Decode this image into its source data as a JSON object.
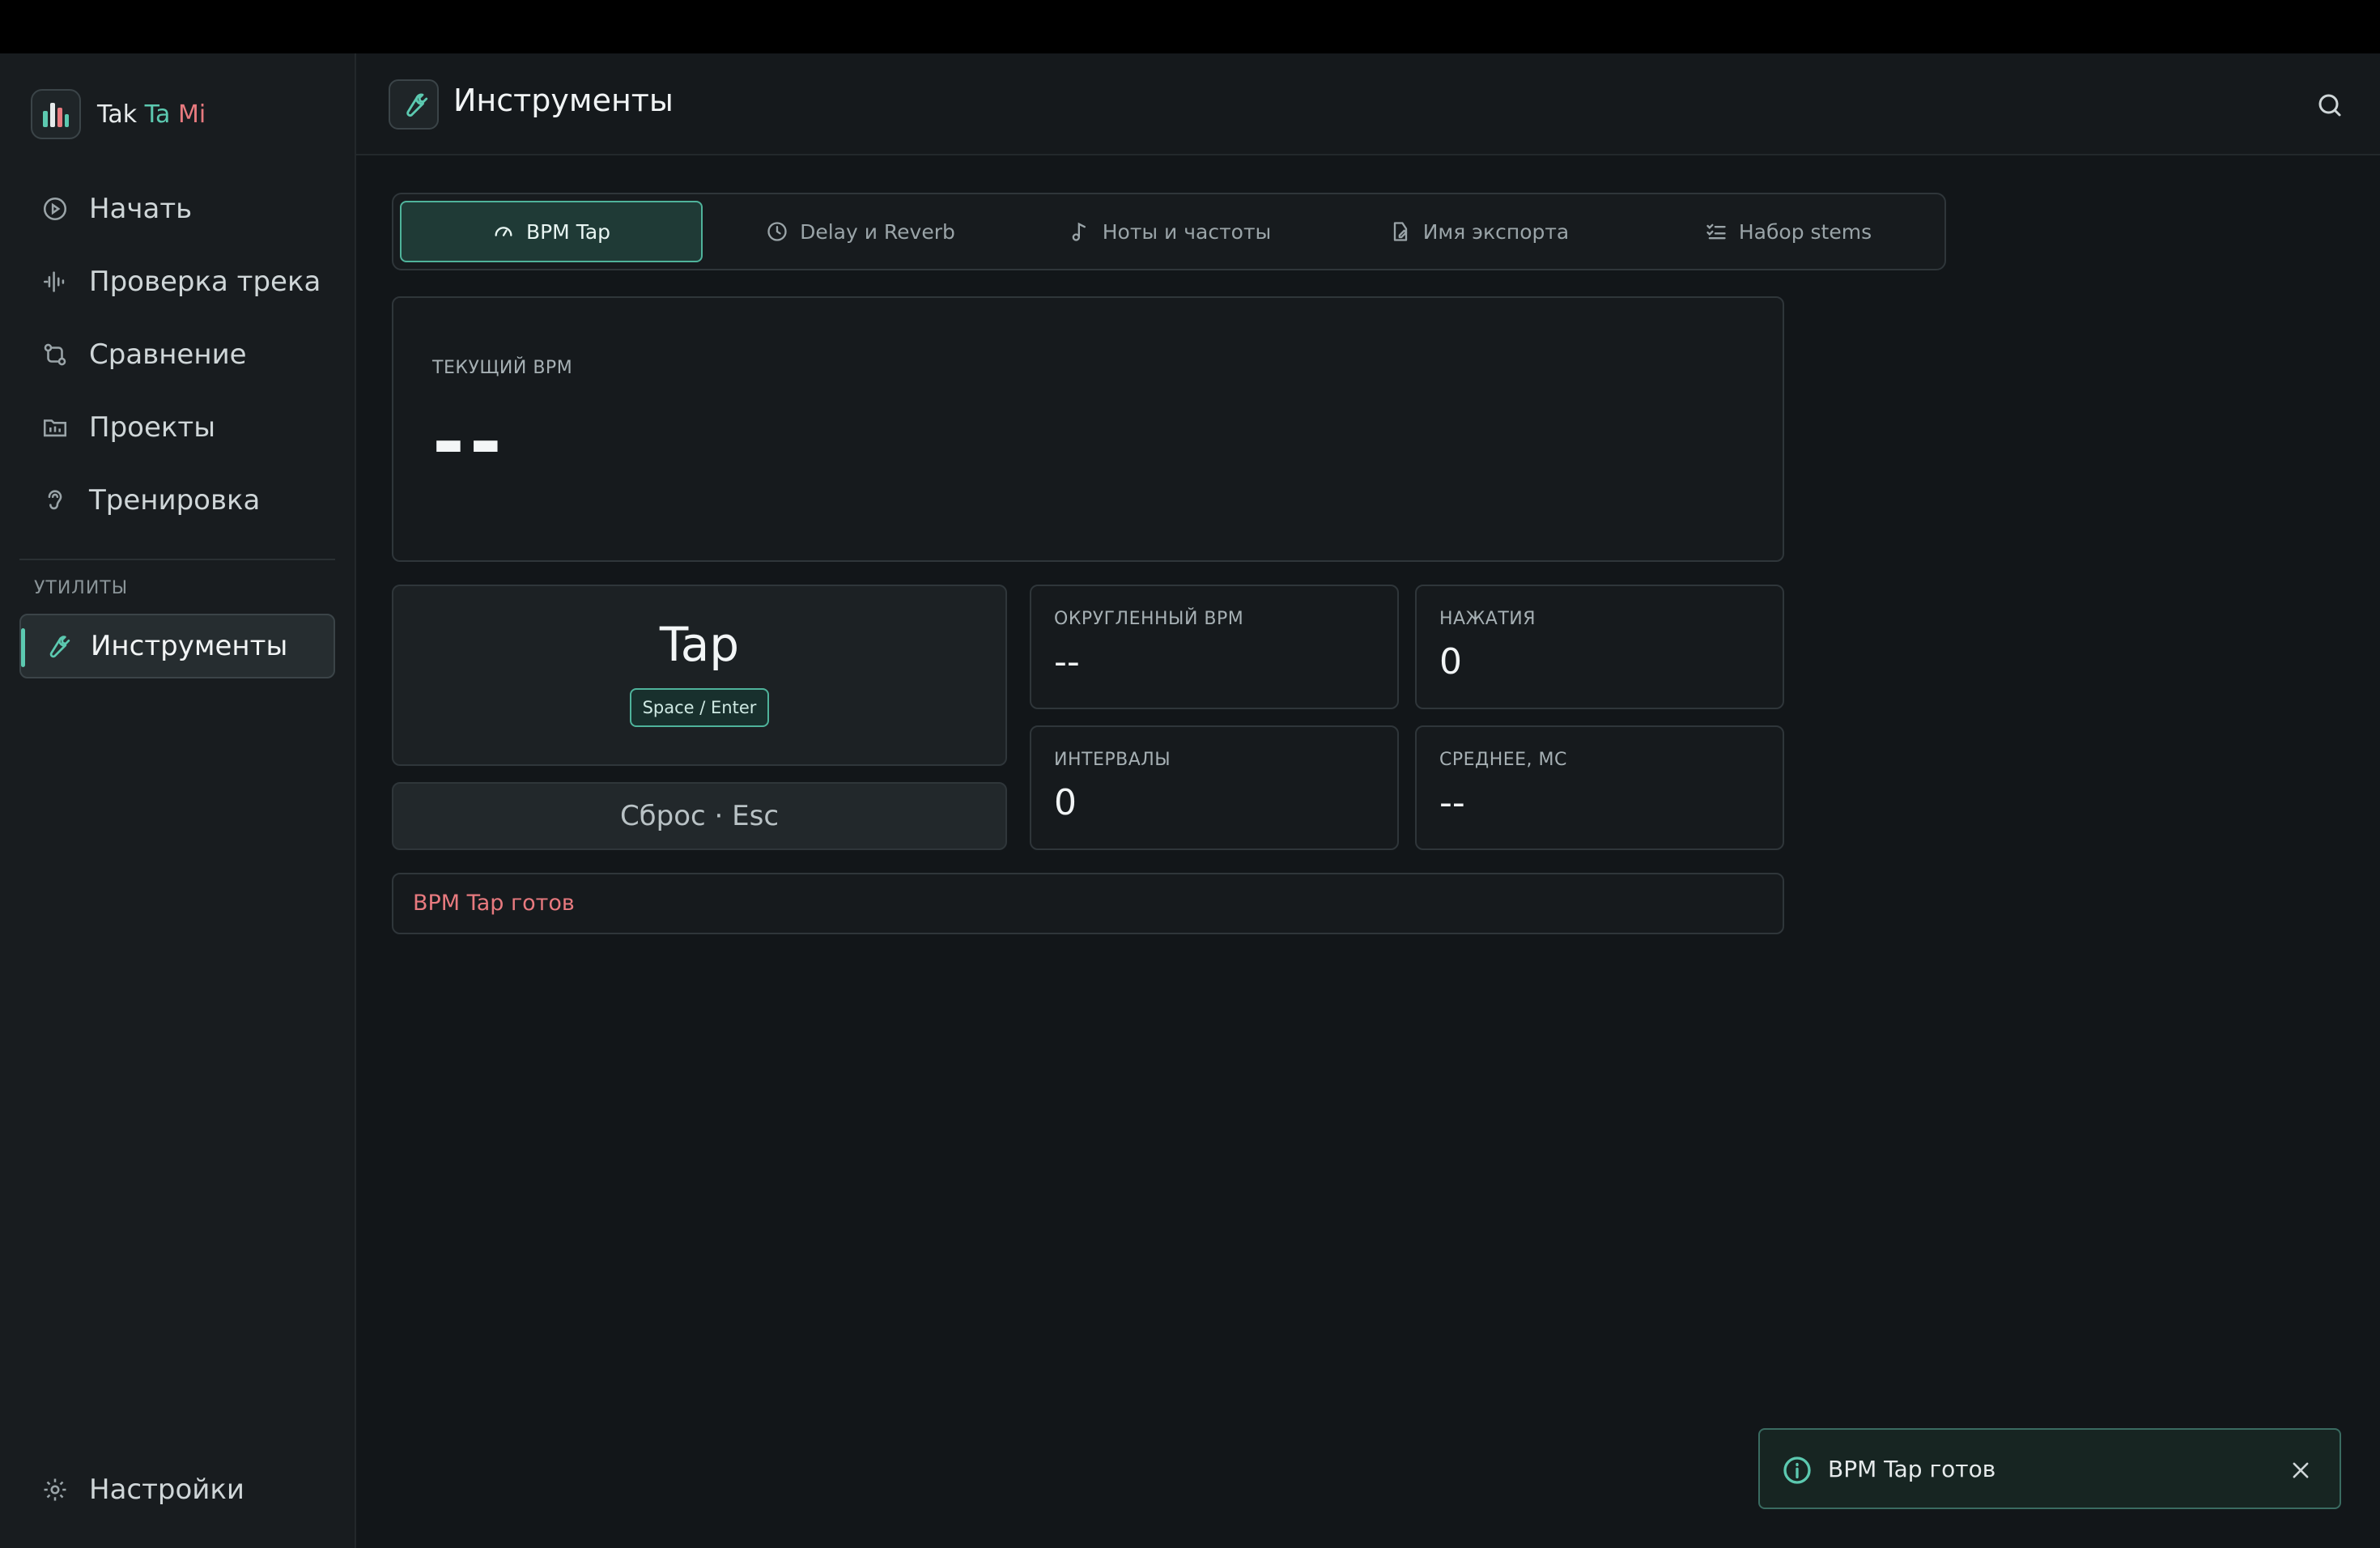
{
  "brand": {
    "tak": "Tak",
    "ta": " Ta",
    "mi": " Mi"
  },
  "sidebar": {
    "items": [
      {
        "label": "Начать",
        "icon": "play-circle-icon"
      },
      {
        "label": "Проверка трека",
        "icon": "waveform-icon"
      },
      {
        "label": "Сравнение",
        "icon": "compare-icon"
      },
      {
        "label": "Проекты",
        "icon": "folder-icon"
      },
      {
        "label": "Тренировка",
        "icon": "ear-icon"
      }
    ],
    "section_label": "УТИЛИТЫ",
    "active_item": {
      "label": "Инструменты",
      "icon": "wrench-icon"
    },
    "settings": {
      "label": "Настройки",
      "icon": "gear-icon"
    }
  },
  "header": {
    "title": "Инструменты"
  },
  "tabs": [
    {
      "label": "BPM Tap",
      "icon": "gauge-icon",
      "active": true
    },
    {
      "label": "Delay и Reverb",
      "icon": "clock-icon",
      "active": false
    },
    {
      "label": "Ноты и частоты",
      "icon": "music-note-icon",
      "active": false
    },
    {
      "label": "Имя экспорта",
      "icon": "edit-file-icon",
      "active": false
    },
    {
      "label": "Набор stems",
      "icon": "checklist-icon",
      "active": false
    }
  ],
  "bpm": {
    "current_label": "ТЕКУЩИЙ BPM",
    "current_value": "--",
    "tap_label": "Tap",
    "tap_hint": "Space / Enter",
    "reset_label": "Сброс · Esc",
    "rounded_label": "ОКРУГЛЕННЫЙ BPM",
    "rounded_value": "--",
    "taps_label": "НАЖАТИЯ",
    "taps_value": "0",
    "intervals_label": "ИНТЕРВАЛЫ",
    "intervals_value": "0",
    "avg_label": "СРЕДНЕЕ, МС",
    "avg_value": "--",
    "status": "BPM Tap готов"
  },
  "toast": {
    "text": "BPM Tap готов"
  },
  "colors": {
    "accent": "#5cc9b0",
    "brand_red": "#e87a7f",
    "background": "#121619"
  }
}
